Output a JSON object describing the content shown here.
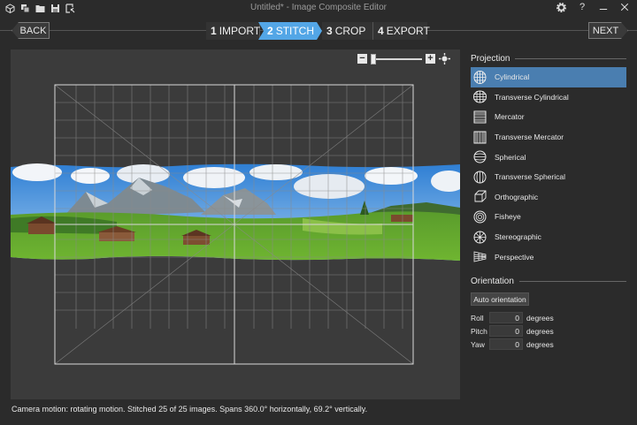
{
  "window": {
    "title": "Untitled* - Image Composite Editor",
    "toolbar_icons": [
      "new-project-icon",
      "new-panorama-icon",
      "open-icon",
      "save-icon",
      "options-icon"
    ],
    "controls": [
      "settings-icon",
      "help-icon",
      "minimize-icon",
      "close-icon"
    ]
  },
  "nav": {
    "back_label": "BACK",
    "next_label": "NEXT",
    "steps": [
      {
        "num": "1",
        "label": "IMPORT"
      },
      {
        "num": "2",
        "label": "STITCH"
      },
      {
        "num": "3",
        "label": "CROP"
      },
      {
        "num": "4",
        "label": "EXPORT"
      }
    ],
    "active_step": "2"
  },
  "canvas": {
    "zoom_out": "−",
    "zoom_in": "+",
    "zoom_level": 0
  },
  "status": "Camera motion: rotating motion. Stitched 25 of 25 images. Spans 360.0° horizontally, 69.2° vertically.",
  "projection": {
    "title": "Projection",
    "items": [
      {
        "label": "Cylindrical",
        "icon": "cylindrical-icon"
      },
      {
        "label": "Transverse Cylindrical",
        "icon": "transverse-cylindrical-icon"
      },
      {
        "label": "Mercator",
        "icon": "mercator-icon"
      },
      {
        "label": "Transverse Mercator",
        "icon": "transverse-mercator-icon"
      },
      {
        "label": "Spherical",
        "icon": "spherical-icon"
      },
      {
        "label": "Transverse Spherical",
        "icon": "transverse-spherical-icon"
      },
      {
        "label": "Orthographic",
        "icon": "orthographic-icon"
      },
      {
        "label": "Fisheye",
        "icon": "fisheye-icon"
      },
      {
        "label": "Stereographic",
        "icon": "stereographic-icon"
      },
      {
        "label": "Perspective",
        "icon": "perspective-icon"
      }
    ],
    "selected": "Cylindrical"
  },
  "orientation": {
    "title": "Orientation",
    "auto_label": "Auto orientation",
    "fields": [
      {
        "label": "Roll",
        "value": "0",
        "unit": "degrees"
      },
      {
        "label": "Pitch",
        "value": "0",
        "unit": "degrees"
      },
      {
        "label": "Yaw",
        "value": "0",
        "unit": "degrees"
      }
    ]
  },
  "colors": {
    "accent": "#53a6e6",
    "selected": "#4a7eb0",
    "background": "#2b2b2b",
    "canvas": "#3b3b3b"
  }
}
